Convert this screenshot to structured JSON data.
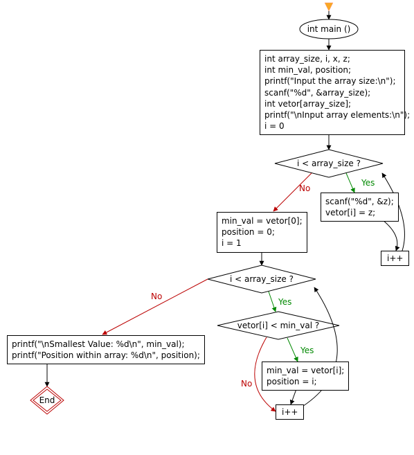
{
  "startNode": "int main ()",
  "initBlock": "int array_size, i, x, z;\nint min_val, position;\nprintf(\"Input the array size:\\n\");\nscanf(\"%d\", &array_size);\nint vetor[array_size];\nprintf(\"\\nInput array elements:\\n\");\ni = 0",
  "cond1": "i < array_size ?",
  "readBlock": "scanf(\"%d\", &z);\nvetor[i] = z;",
  "inc1": "i++",
  "afterLoop1": "min_val = vetor[0];\nposition = 0;\ni = 1",
  "cond2": "i < array_size ?",
  "cond3": "vetor[i] < min_val ?",
  "updateMin": "min_val = vetor[i];\nposition = i;",
  "inc2": "i++",
  "printBlock": "printf(\"\\nSmallest Value: %d\\n\", min_val);\nprintf(\"Position within array: %d\\n\", position);",
  "endNode": "End",
  "yes": "Yes",
  "no": "No",
  "chart_data": {
    "type": "flowchart",
    "nodes": [
      {
        "id": "start",
        "kind": "terminator",
        "label_path": "startNode"
      },
      {
        "id": "init",
        "kind": "process",
        "label_path": "initBlock"
      },
      {
        "id": "cond1",
        "kind": "decision",
        "label_path": "cond1"
      },
      {
        "id": "read",
        "kind": "process",
        "label_path": "readBlock"
      },
      {
        "id": "inc1",
        "kind": "process",
        "label_path": "inc1"
      },
      {
        "id": "after1",
        "kind": "process",
        "label_path": "afterLoop1"
      },
      {
        "id": "cond2",
        "kind": "decision",
        "label_path": "cond2"
      },
      {
        "id": "cond3",
        "kind": "decision",
        "label_path": "cond3"
      },
      {
        "id": "update",
        "kind": "process",
        "label_path": "updateMin"
      },
      {
        "id": "inc2",
        "kind": "process",
        "label_path": "inc2"
      },
      {
        "id": "print",
        "kind": "process",
        "label_path": "printBlock"
      },
      {
        "id": "end",
        "kind": "terminator",
        "label_path": "endNode"
      }
    ],
    "edges": [
      {
        "from": "entry",
        "to": "start"
      },
      {
        "from": "start",
        "to": "init"
      },
      {
        "from": "init",
        "to": "cond1"
      },
      {
        "from": "cond1",
        "to": "read",
        "label": "Yes"
      },
      {
        "from": "read",
        "to": "inc1"
      },
      {
        "from": "inc1",
        "to": "cond1"
      },
      {
        "from": "cond1",
        "to": "after1",
        "label": "No"
      },
      {
        "from": "after1",
        "to": "cond2"
      },
      {
        "from": "cond2",
        "to": "cond3",
        "label": "Yes"
      },
      {
        "from": "cond3",
        "to": "update",
        "label": "Yes"
      },
      {
        "from": "update",
        "to": "inc2"
      },
      {
        "from": "cond3",
        "to": "inc2",
        "label": "No"
      },
      {
        "from": "inc2",
        "to": "cond2"
      },
      {
        "from": "cond2",
        "to": "print",
        "label": "No"
      },
      {
        "from": "print",
        "to": "end"
      }
    ]
  }
}
